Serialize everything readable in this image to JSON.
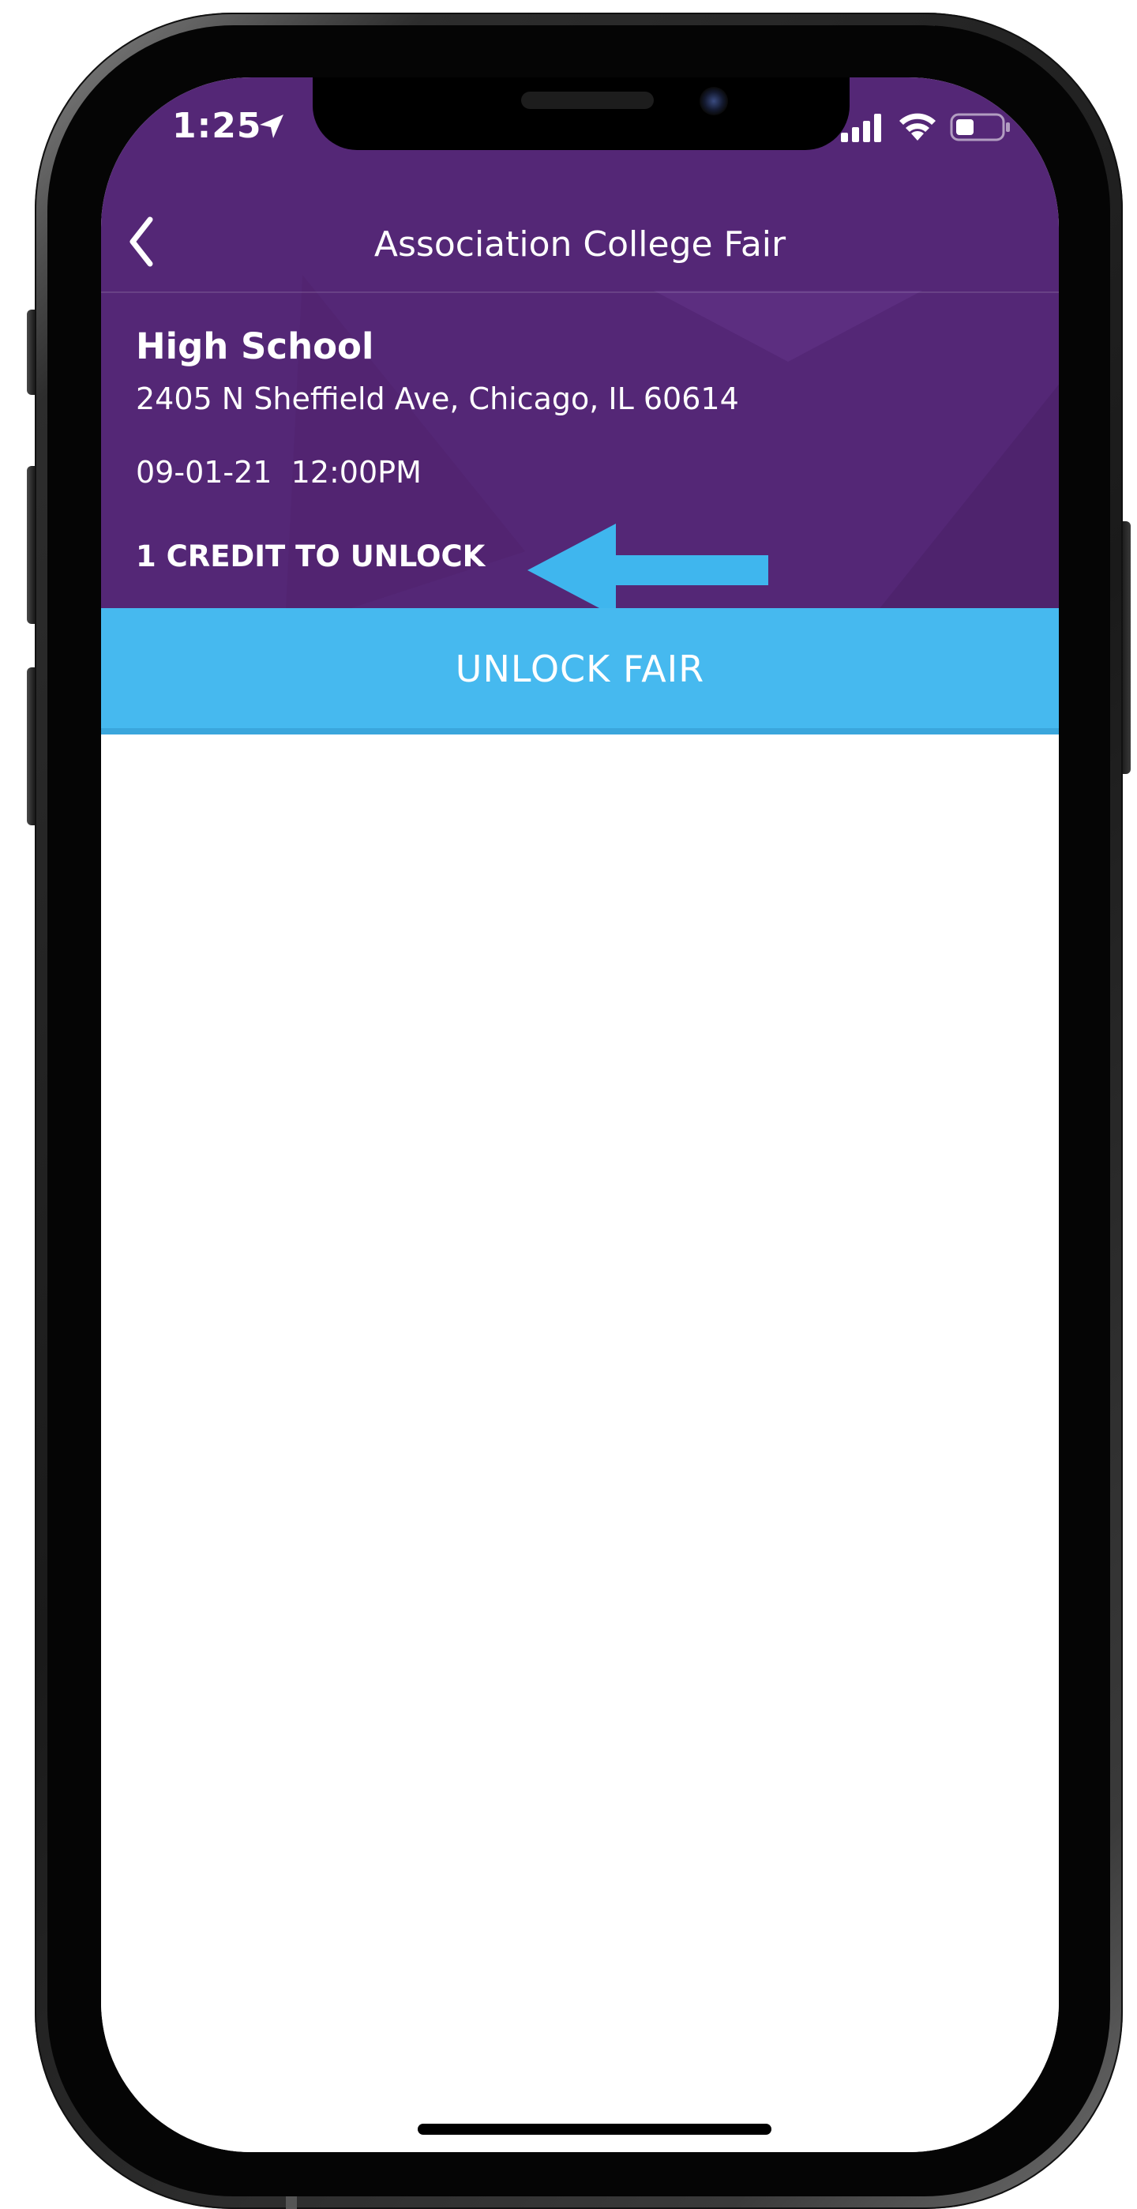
{
  "status_bar": {
    "time": "1:25",
    "icons": [
      "location-arrow-icon",
      "cellular-signal-icon",
      "wifi-icon",
      "battery-icon"
    ]
  },
  "nav": {
    "back_icon": "chevron-left-icon",
    "title": "Association College Fair"
  },
  "fair": {
    "school": "High School",
    "address": "2405 N Sheffield Ave, Chicago, IL 60614",
    "datetime": "09-01-21  12:00PM",
    "credit_note": "1 CREDIT TO UNLOCK"
  },
  "annotation": {
    "icon": "arrow-left-icon",
    "color": "#3fb6ee"
  },
  "actions": {
    "unlock_label": "UNLOCK FAIR"
  },
  "colors": {
    "header_purple": "#542776",
    "unlock_blue": "#46b9ef"
  }
}
